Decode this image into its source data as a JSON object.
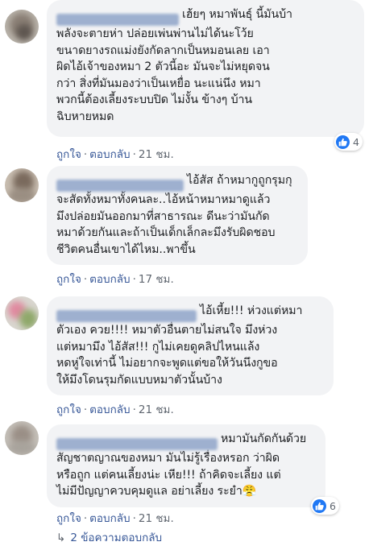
{
  "colors": {
    "link": "#385898",
    "meta": "#606770",
    "bubble": "#f2f3f5",
    "like_badge": "#2078f4"
  },
  "comments": [
    {
      "lines": [
        "เฮ้ยๆ หมาพันธุ์ นี้มันบ้า",
        "พลังจะตายห่า ปล่อยเพ่นพ่านไม่ได้นะโว้ย",
        "ขนาดยางรถแม่งยังกัดลากเป็นหมอนเลย เอา",
        "ผิดไอ้เจ้าของหมา 2 ตัวนี้อะ มันจะไม่หยุดจน",
        "กว่า สิ่งที่มันมองว่าเป็นเหยื่อ นะแน่นึง หมา",
        "พวกนี้ต้องเลี้ยงระบบปิด ไม่งั้น ข้างๆ บ้าน",
        "ฉิบหายหมด"
      ],
      "like": "ถูกใจ",
      "reply": "ตอบกลับ",
      "time": "21 ชม.",
      "reactions": "4"
    },
    {
      "lines": [
        "ไอ้สัส ถ้าหมากูถูกรุมกุ",
        "จะสัดทั้งหมาทั้งคนละ..ไอ้หน้าหมาหมาดูแล้ว",
        "มึงปล่อยมันออกมาที่สาธารณะ ดีนะว่ามันกัด",
        "หมาด้วยกันและถ้าเป็นเด็กเล็กละมึงรับผิดชอบ",
        "ชีวิตคนอื่นเขาได้ไหม..พาขึ้น"
      ],
      "like": "ถูกใจ",
      "reply": "ตอบกลับ",
      "time": "17 ชม.",
      "reactions": ""
    },
    {
      "lines": [
        "ไอ้เหี้ย!!! ห่วงแต่หมา",
        "ตัวเอง ควย!!!! หมาตัวอื่นตายไม่สนใจ มึงห่วง",
        "แต่หมามึง ไอ้สัส!!! กูไม่เคยดูคลิปไหนแล้ง",
        "หดหู่ใจเท่านี้ ไม่อยากจะพูดแต่ขอให้วันนึงกูขอ",
        "ให้มึงโดนรุมกัดแบบหมาตัวนั้นบ้าง"
      ],
      "like": "ถูกใจ",
      "reply": "ตอบกลับ",
      "time": "21 ชม.",
      "reactions": ""
    },
    {
      "lines": [
        "หมามันกัดกันด้วย",
        "สัญชาตญาณของหมา มันไม่รู้เรื่องหรอก ว่าผิด",
        "หรือถูก แต่คนเลี้ยงน่ะ เหีย!!! ถ้าคิดจะเลี้ยง แต่",
        "ไม่มีปัญญาควบคุมดูแล อย่าเลี้ยง ระยำ😤"
      ],
      "like": "ถูกใจ",
      "reply": "ตอบกลับ",
      "time": "21 ชม.",
      "reactions": "6"
    }
  ],
  "more_replies": "2 ข้อความตอบกลับ"
}
